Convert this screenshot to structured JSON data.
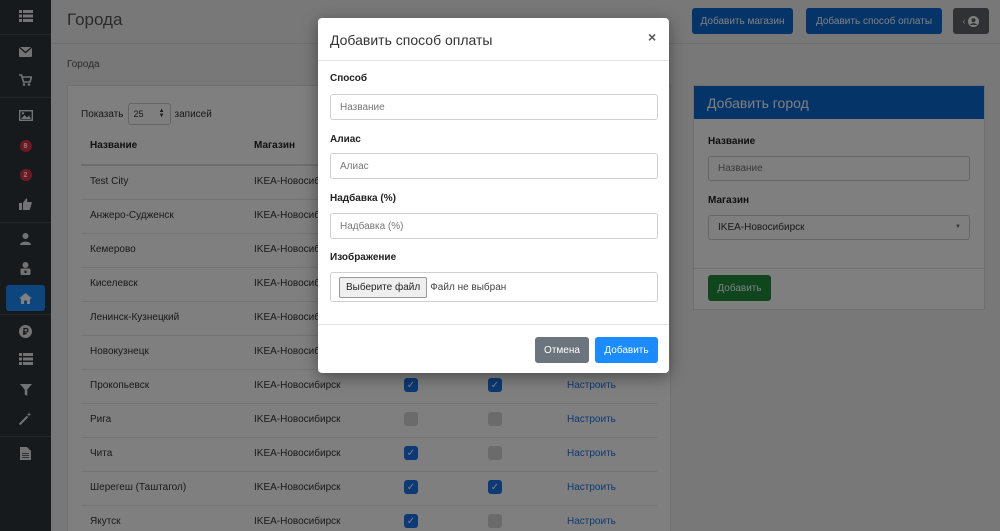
{
  "sidebar": {
    "items": [
      {
        "icon": "list-icon"
      },
      {
        "icon": "envelope-icon"
      },
      {
        "icon": "cart-icon"
      },
      {
        "icon": "image-icon"
      },
      {
        "icon": "badge-icon",
        "badge": "8"
      },
      {
        "icon": "badge-icon",
        "badge": "2"
      },
      {
        "icon": "thumbs-up-icon"
      },
      {
        "icon": "user-icon"
      },
      {
        "icon": "lock-user-icon"
      },
      {
        "icon": "home-icon",
        "active": true
      },
      {
        "icon": "ruble-icon"
      },
      {
        "icon": "list-icon"
      },
      {
        "icon": "filter-icon"
      },
      {
        "icon": "magic-wand-icon"
      },
      {
        "icon": "document-icon"
      }
    ]
  },
  "header": {
    "title": "Города",
    "add_store_label": "Добавить магазин",
    "add_payment_label": "Добавить способ оплаты"
  },
  "breadcrumb": "Города",
  "table": {
    "show_label": "Показать",
    "show_value": "25",
    "records_label": "записей",
    "columns": [
      "Название",
      "Магазин"
    ],
    "rows": [
      {
        "name": "Test City",
        "store": "IKEA-Новосибирск"
      },
      {
        "name": "Анжеро-Судженск",
        "store": "IKEA-Новосибирск"
      },
      {
        "name": "Кемерово",
        "store": "IKEA-Новосибирск"
      },
      {
        "name": "Киселевск",
        "store": "IKEA-Новосибирск"
      },
      {
        "name": "Ленинск-Кузнецкий",
        "store": "IKEA-Новосибирск"
      },
      {
        "name": "Новокузнецк",
        "store": "IKEA-Новосибирск"
      },
      {
        "name": "Прокопьевск",
        "store": "IKEA-Новосибирск",
        "check1": true,
        "check2": true,
        "link": "Настроить"
      },
      {
        "name": "Рига",
        "store": "IKEA-Новосибирск",
        "check1": false,
        "check2": false,
        "link": "Настроить"
      },
      {
        "name": "Чита",
        "store": "IKEA-Новосибирск",
        "check1": true,
        "check2": false,
        "link": "Настроить"
      },
      {
        "name": "Шерегеш (Таштагол)",
        "store": "IKEA-Новосибирск",
        "check1": true,
        "check2": true,
        "link": "Настроить"
      },
      {
        "name": "Якутск",
        "store": "IKEA-Новосибирск",
        "check1": true,
        "check2": false,
        "link": "Настроить"
      }
    ]
  },
  "add_city": {
    "title": "Добавить город",
    "name_label": "Название",
    "name_placeholder": "Название",
    "store_label": "Магазин",
    "store_value": "IKEA-Новосибирск",
    "submit_label": "Добавить"
  },
  "modal": {
    "title": "Добавить способ оплаты",
    "close": "×",
    "method_label": "Способ",
    "method_placeholder": "Название",
    "alias_label": "Алиас",
    "alias_placeholder": "Алиас",
    "markup_label": "Надбавка (%)",
    "markup_placeholder": "Надбавка (%)",
    "image_label": "Изображение",
    "file_button": "Выберите файл",
    "file_status": "Файл не выбран",
    "cancel_label": "Отмена",
    "submit_label": "Добавить"
  }
}
